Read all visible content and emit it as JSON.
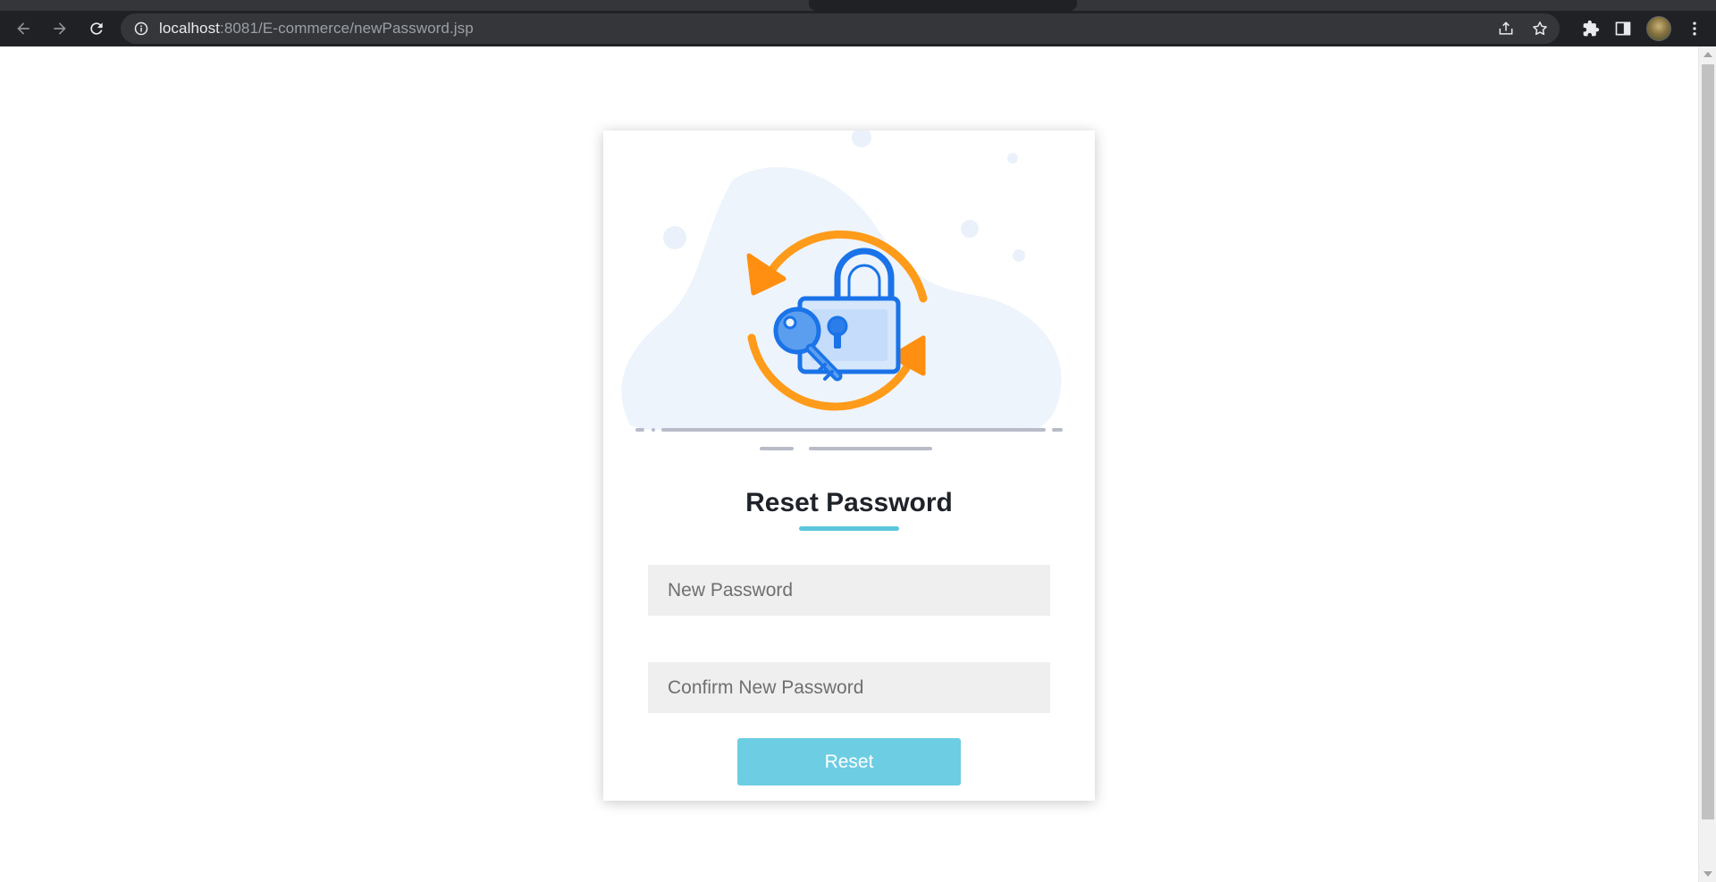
{
  "browser": {
    "url_host": "localhost",
    "url_rest": ":8081/E-commerce/newPassword.jsp"
  },
  "page": {
    "title": "Reset Password",
    "new_password_placeholder": "New Password",
    "confirm_password_placeholder": "Confirm New Password",
    "reset_label": "Reset"
  },
  "colors": {
    "accent": "#6dcde3",
    "title_underline": "#5bc6dc",
    "field_background": "#efefef",
    "illustration_orange": "#ff9b1a",
    "illustration_blue": "#1a73e8",
    "blob_background": "#eef4fb"
  },
  "icons": {
    "back": "arrow-left-icon",
    "forward": "arrow-right-icon",
    "reload": "reload-icon",
    "site_info": "info-icon",
    "share": "share-icon",
    "bookmark": "star-icon",
    "extensions": "puzzle-icon",
    "side_panel": "side-panel-icon",
    "menu": "kebab-menu-icon",
    "illustration": "padlock-key-refresh-icon"
  }
}
